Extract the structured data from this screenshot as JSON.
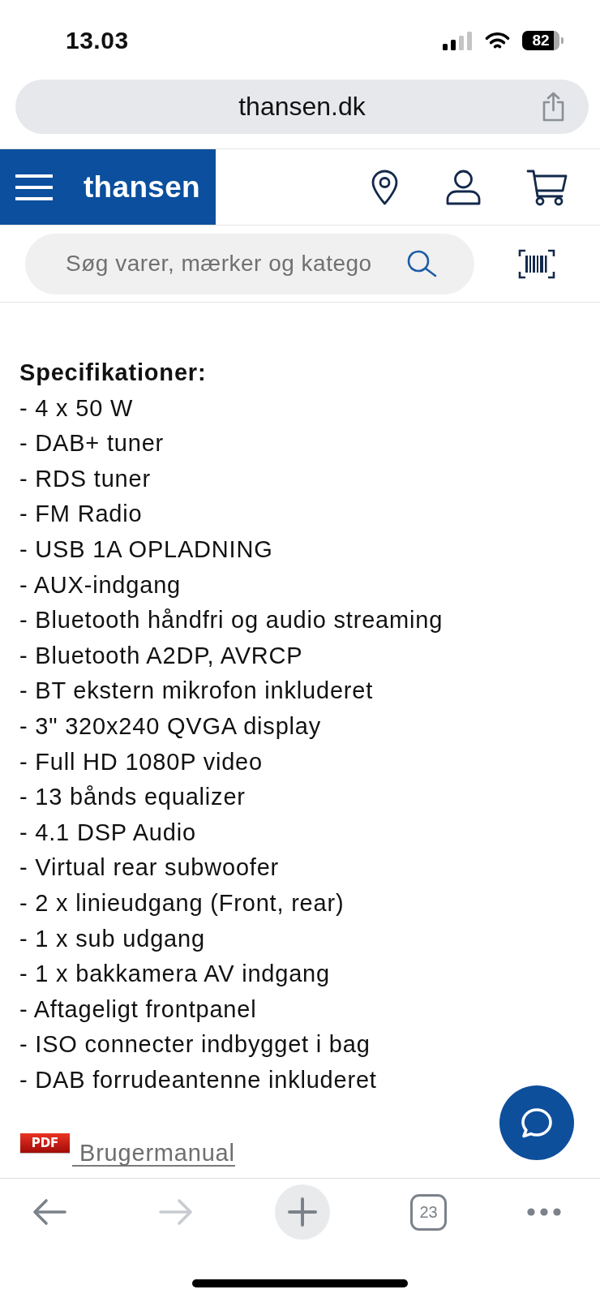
{
  "status_bar": {
    "time": "13.03",
    "battery": "82"
  },
  "address_bar": {
    "url": "thansen.dk"
  },
  "header": {
    "logo": "thansen"
  },
  "search": {
    "placeholder": "Søg varer, mærker og katego"
  },
  "content": {
    "heading": "Specifikationer:",
    "specs": [
      "- 4 x 50 W",
      "- DAB+ tuner",
      "- RDS tuner",
      "- FM Radio",
      "- USB 1A OPLADNING",
      "- AUX-indgang",
      "- Bluetooth håndfri og audio streaming",
      "- Bluetooth A2DP, AVRCP",
      "- BT ekstern mikrofon inkluderet",
      "- 3\" 320x240 QVGA display",
      "- Full HD 1080P video",
      "- 13 bånds equalizer",
      "- 4.1 DSP Audio",
      "- Virtual rear subwoofer",
      "- 2 x linieudgang (Front, rear)",
      "- 1 x sub udgang",
      "- 1 x bakkamera AV indgang",
      "- Aftageligt frontpanel",
      "- ISO connecter indbygget i bag",
      "- DAB forrudeantenne inkluderet"
    ],
    "attachment": {
      "badge": "PDF",
      "link": "Brugermanual"
    }
  },
  "toolbar": {
    "items": [
      {
        "kind": "back",
        "disabled": false
      },
      {
        "kind": "forward",
        "disabled": true
      },
      {
        "kind": "new-tab",
        "disabled": false
      },
      {
        "kind": "tabs",
        "label": "23",
        "disabled": false
      },
      {
        "kind": "more",
        "disabled": false
      }
    ]
  }
}
